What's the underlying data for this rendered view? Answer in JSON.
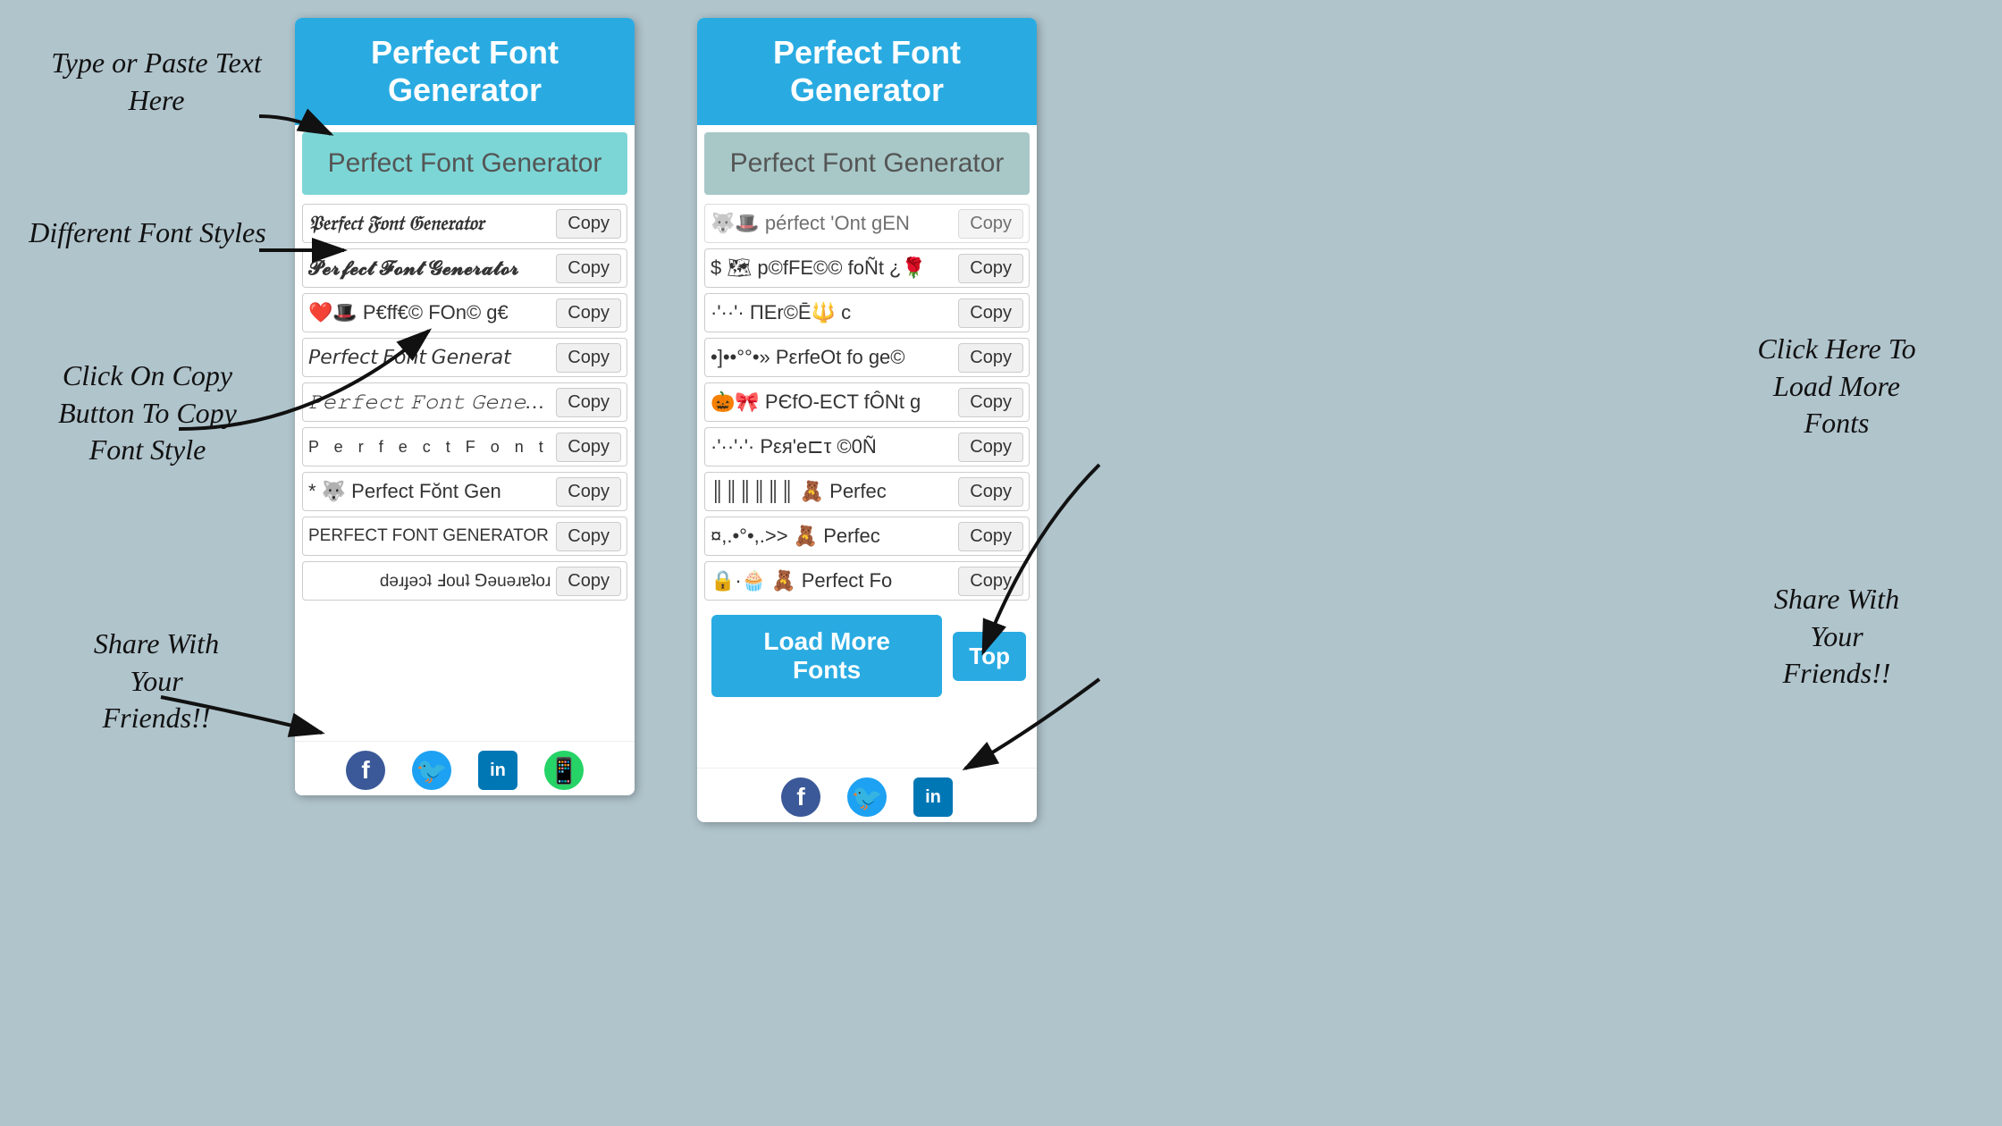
{
  "annotations": {
    "type_paste": "Type or Paste Text\nHere",
    "different_fonts": "Different Font\nStyles",
    "click_copy": "Click On Copy\nButton To Copy\nFont Style",
    "share_left": "Share With\nYour\nFriends!!",
    "click_load": "Click Here To\nLoad More\nFonts",
    "share_right": "Share With\nYour\nFriends!!"
  },
  "phone1": {
    "header": "Perfect Font Generator",
    "input_placeholder": "Perfect Font Generator",
    "font_rows": [
      {
        "text": "𝔓𝔢𝔯𝔣𝔢𝔠𝔱 𝔉𝔬𝔫𝔱 𝔊𝔢𝔫𝔢𝔯𝔞𝔱𝔬𝔯",
        "copy": "Copy",
        "style": "f1"
      },
      {
        "text": "𝓟𝓮𝓻𝓯𝓮𝓬𝓽 𝓕𝓸𝓷𝓽 𝓖𝓮𝓷𝓮𝓻𝓪𝓽𝓸𝓻",
        "copy": "Copy",
        "style": "f2"
      },
      {
        "text": "❤️🎩 P€ff€©  FOn© g€",
        "copy": "Copy",
        "style": "f3"
      },
      {
        "text": "𝘗𝘦𝘳𝘧𝘦𝘤𝘵 𝘍𝘰𝘯𝘵 𝘎𝘦𝘯𝘦𝘳𝘢𝘵",
        "copy": "Copy",
        "style": "f4"
      },
      {
        "text": "𝙿𝚎𝚛𝚏𝚎𝚌𝚝 𝙵𝚘𝚗𝚝 𝙶𝚎𝚗𝚎𝚛𝚊𝚝𝚘",
        "copy": "Copy",
        "style": "f5"
      },
      {
        "text": "P e r f e c t  F o n t",
        "copy": "Copy",
        "style": "f6"
      },
      {
        "text": "* 🐺 Perfect Fŏnt Gen",
        "copy": "Copy",
        "style": "f7"
      },
      {
        "text": "PERFECT FONT GENERATOR",
        "copy": "Copy",
        "style": "f8"
      },
      {
        "text": "ɹoʇɐɹǝuǝ⅁ ʇuoℲ ʇɔǝɟɹǝd",
        "copy": "Copy",
        "style": "f9"
      }
    ],
    "social": [
      "f",
      "t",
      "in",
      "w"
    ]
  },
  "phone2": {
    "header": "Perfect Font Generator",
    "input_placeholder": "Perfect Font Generator",
    "font_rows": [
      {
        "text": "🐺🎩 pérfECt 'Ont gEN",
        "copy": "Copy",
        "style": "f10"
      },
      {
        "text": "$ 🗺 p©fFE©© foÑt ¿🌹",
        "copy": "Copy",
        "style": "f11"
      },
      {
        "text": "·'··'·  ΠΕr©Ē🔱 c",
        "copy": "Copy",
        "style": "f12"
      },
      {
        "text": "•]••°°•» PεrfeОt fo᷊ ge©",
        "copy": "Copy",
        "style": "f13"
      },
      {
        "text": "🎃🎀 PЄfО-ЕCT fÔNt g",
        "copy": "Copy",
        "style": "f10"
      },
      {
        "text": "·'··'·'· Pεя'е⊏τ ©0Ñ",
        "copy": "Copy",
        "style": "f11"
      },
      {
        "text": "║║║║║║ 🧸 Perfec",
        "copy": "Copy",
        "style": "f12"
      },
      {
        "text": "¤,.•°•,.>> 🧸 Perfec",
        "copy": "Copy",
        "style": "f13"
      },
      {
        "text": "🔒·🧁 🧸 Perfect Fо",
        "copy": "Copy",
        "style": "f10"
      }
    ],
    "load_more": "Load More Fonts",
    "top_btn": "Top",
    "social": [
      "f",
      "t",
      "in"
    ]
  }
}
